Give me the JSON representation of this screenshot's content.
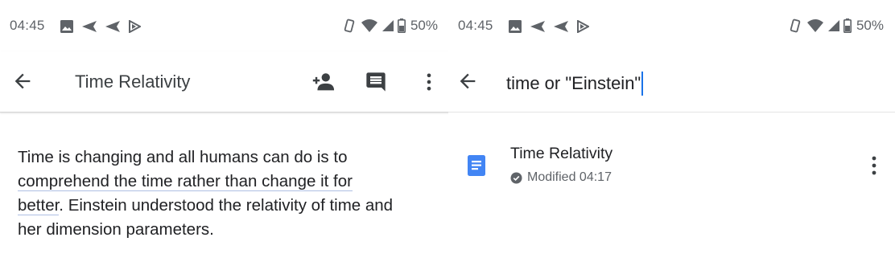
{
  "left_screen": {
    "status": {
      "time": "04:45",
      "battery": "50%"
    },
    "toolbar": {
      "title": "Time Relativity"
    },
    "document": {
      "line1": "Time is changing and all humans can do is to",
      "line2": "comprehend the time rather than change it for",
      "line3_highlight": "better",
      "line3_rest": ". Einstein understood the relativity of time and",
      "line4": "her dimension parameters."
    },
    "icons": [
      "back-arrow-icon",
      "add-person-icon",
      "comment-icon",
      "more-vert-icon"
    ]
  },
  "right_screen": {
    "status": {
      "time": "04:45",
      "battery": "50%"
    },
    "search": {
      "query": "time or \"Einstein\""
    },
    "results": [
      {
        "title": "Time Relativity",
        "meta": "Modified 04:17"
      }
    ],
    "icons": [
      "back-arrow-icon",
      "docs-icon",
      "check-circle-icon",
      "more-vert-icon"
    ]
  },
  "colors": {
    "accent": "#1a73e8",
    "docs_blue": "#4285f4",
    "icon_gray": "#5f6368",
    "dark_icon": "#3c4043"
  }
}
